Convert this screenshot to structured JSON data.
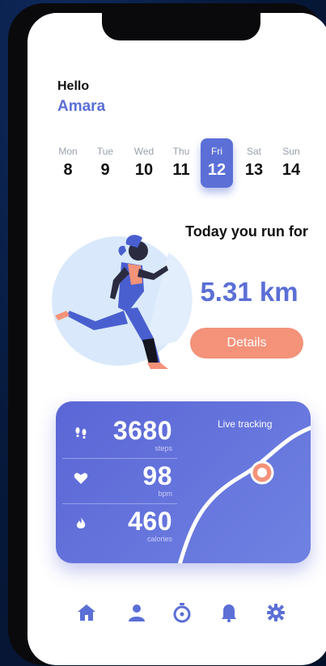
{
  "greeting": {
    "hello": "Hello",
    "name": "Amara"
  },
  "calendar": {
    "days": [
      {
        "label": "Mon",
        "date": "8"
      },
      {
        "label": "Tue",
        "date": "9"
      },
      {
        "label": "Wed",
        "date": "10"
      },
      {
        "label": "Thu",
        "date": "11"
      },
      {
        "label": "Fri",
        "date": "12",
        "selected": true
      },
      {
        "label": "Sat",
        "date": "13"
      },
      {
        "label": "Sun",
        "date": "14"
      }
    ]
  },
  "run": {
    "title": "Today you run for",
    "distance": "5.31 km",
    "details_label": "Details"
  },
  "tracking": {
    "title": "Live tracking",
    "stats": [
      {
        "icon": "footsteps-icon",
        "value": "3680",
        "unit": "steps"
      },
      {
        "icon": "heart-icon",
        "value": "98",
        "unit": "bpm"
      },
      {
        "icon": "flame-icon",
        "value": "460",
        "unit": "calories"
      }
    ]
  },
  "nav": {
    "items": [
      "home-icon",
      "profile-icon",
      "timer-icon",
      "notification-bell-icon",
      "settings-gear-icon"
    ],
    "active_color": "#5b6fd6"
  },
  "colors": {
    "accent": "#5b6fd6",
    "button": "#f4927a",
    "card": "#5b66d6"
  }
}
